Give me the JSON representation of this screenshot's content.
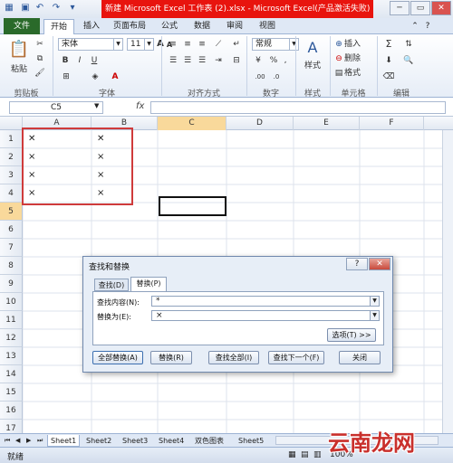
{
  "window": {
    "title": "新建 Microsoft Excel 工作表 (2).xlsx  -  Microsoft Excel(产品激活失败)",
    "controls": [
      "?",
      "▭",
      "✕"
    ]
  },
  "ribbon": {
    "tabs": [
      {
        "label": "文件"
      },
      {
        "label": "开始"
      },
      {
        "label": "插入"
      },
      {
        "label": "页面布局"
      },
      {
        "label": "公式"
      },
      {
        "label": "数据"
      },
      {
        "label": "审阅"
      },
      {
        "label": "视图"
      }
    ],
    "clipboard": {
      "paste": "粘贴",
      "label": "剪贴板"
    },
    "font": {
      "name": "宋体",
      "size": "11",
      "label": "字体",
      "bold": "B",
      "italic": "I",
      "underline": "U",
      "grow": "A",
      "shrink": "A"
    },
    "alignment": {
      "label": "对齐方式"
    },
    "number": {
      "format": "常规",
      "label": "数字",
      "percent": "%",
      "comma": ","
    },
    "styles": {
      "styles": "样式",
      "label": "样式"
    },
    "cells": {
      "insert": "插入",
      "delete": "删除",
      "format": "格式",
      "label": "单元格"
    },
    "editing": {
      "label": "编辑",
      "sum": "Σ"
    }
  },
  "formula_bar": {
    "name_box": "C5",
    "fx": "fx",
    "value": ""
  },
  "grid": {
    "columns": [
      "A",
      "B",
      "C",
      "D",
      "E",
      "F"
    ],
    "rows": [
      "1",
      "2",
      "3",
      "4",
      "5",
      "6",
      "7",
      "8",
      "9",
      "10",
      "11",
      "12",
      "13",
      "14",
      "15",
      "16",
      "17"
    ],
    "cells": [
      {
        "col": "A",
        "row": 1,
        "value": "✕"
      },
      {
        "col": "B",
        "row": 1,
        "value": "✕"
      },
      {
        "col": "A",
        "row": 2,
        "value": "×"
      },
      {
        "col": "B",
        "row": 2,
        "value": "×"
      },
      {
        "col": "A",
        "row": 3,
        "value": "×"
      },
      {
        "col": "B",
        "row": 3,
        "value": "×"
      },
      {
        "col": "A",
        "row": 4,
        "value": "×"
      },
      {
        "col": "B",
        "row": 4,
        "value": "×"
      }
    ],
    "active_cell": "C5"
  },
  "dialog": {
    "title": "查找和替换",
    "help": "?",
    "close_x": "✕",
    "tabs": [
      "查找(D)",
      "替换(P)"
    ],
    "find_label": "查找内容(N):",
    "find_value": "*",
    "replace_label": "替换为(E):",
    "replace_value": "×",
    "options_button": "选项(T) >>",
    "buttons": [
      "全部替换(A)",
      "替换(R)",
      "查找全部(I)",
      "查找下一个(F)",
      "关闭"
    ]
  },
  "sheets": {
    "tabs": [
      "Sheet1",
      "Sheet2",
      "Sheet3",
      "Sheet4",
      "双色图表",
      "Sheet5"
    ],
    "active_index": 0
  },
  "status": {
    "text": "就绪",
    "zoom": "100%"
  },
  "watermark": "云南龙网",
  "colors": {
    "accent_red": "#e8140e",
    "file_tab": "#2a6a2a",
    "highlight_box": "#cf3b3b"
  }
}
